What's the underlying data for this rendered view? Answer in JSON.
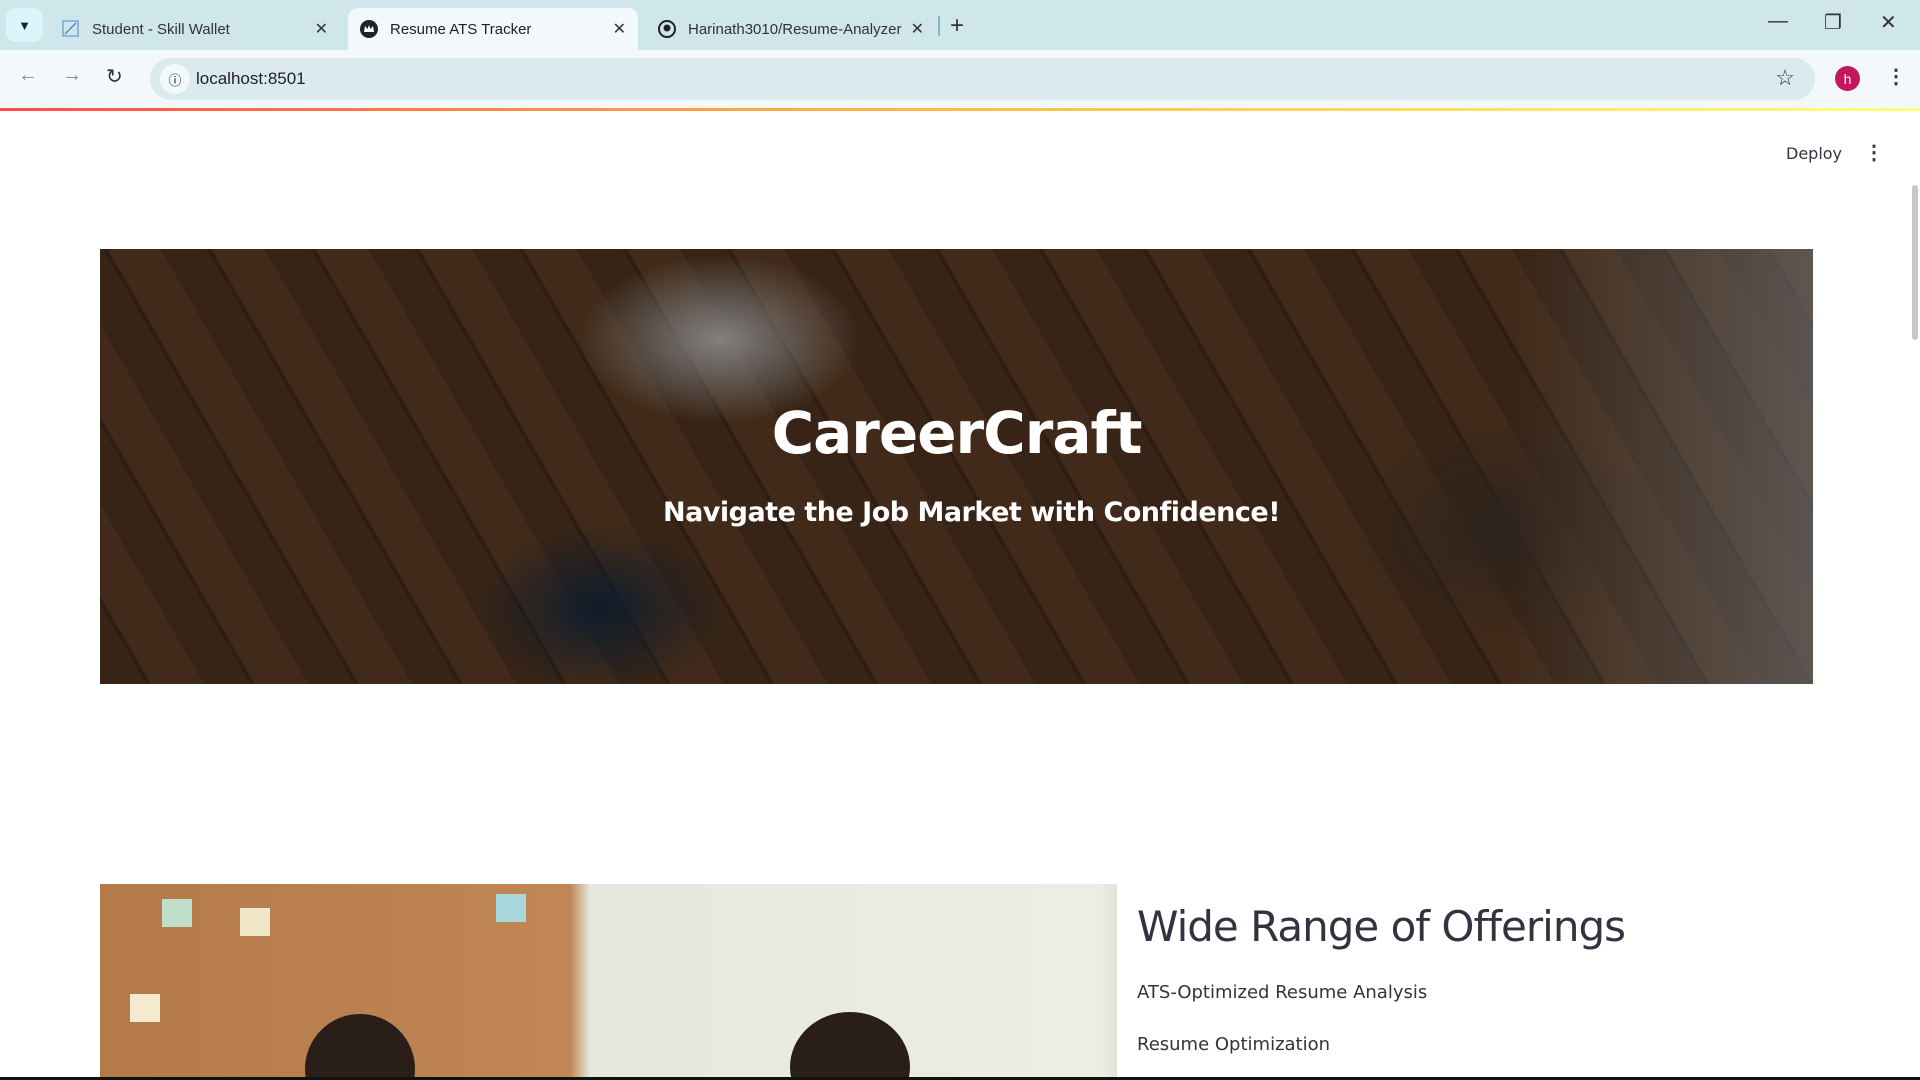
{
  "browser": {
    "tabs": [
      {
        "title": "Student - Skill Wallet",
        "icon": "skill-wallet-icon"
      },
      {
        "title": "Resume ATS Tracker",
        "icon": "streamlit-crown-icon",
        "active": true
      },
      {
        "title": "Harinath3010/Resume-Analyzer",
        "icon": "github-icon"
      }
    ],
    "url": "localhost:8501",
    "profile_initial": "h"
  },
  "app": {
    "deploy_label": "Deploy",
    "hero": {
      "title": "CareerCraft",
      "subtitle": "Navigate the Job Market with Confidence!"
    },
    "offerings": {
      "heading": "Wide Range of Offerings",
      "items": [
        "ATS-Optimized Resume Analysis",
        "Resume Optimization"
      ]
    }
  }
}
